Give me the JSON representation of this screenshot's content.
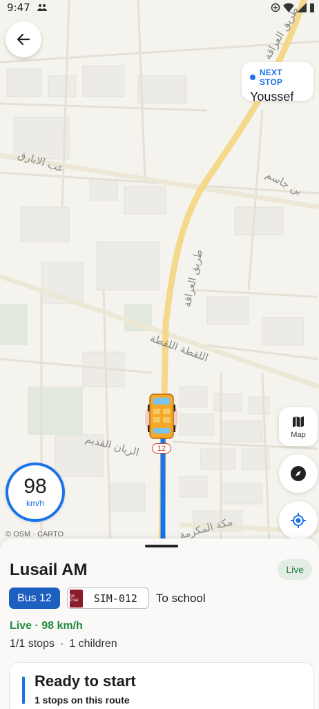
{
  "status_bar": {
    "time": "9:47"
  },
  "map": {
    "next_stop_label": "NEXT STOP",
    "next_stop_name": "Youssef",
    "map_button_label": "Map",
    "speed_value": "98",
    "speed_unit": "km/h",
    "attribution": "© OSM · CARTO",
    "route_number_badge": "12",
    "street_labels": [
      "طريق العراقة",
      "عب الابارق",
      "بن جاسم",
      "اللقطة اللقطة",
      "الريان القديم",
      "مكة المكرمة"
    ]
  },
  "sheet": {
    "route_name": "Lusail AM",
    "live_badge": "Live",
    "bus_label": "Bus 12",
    "plate_flag": "QA KTAR",
    "plate_number": "SIM-012",
    "direction": "To school",
    "live_speed": "Live · 98 km/h",
    "stops": "1/1 stops",
    "separator": "·",
    "children": "1 children",
    "card_title": "Ready to start",
    "card_subtitle": "1 stops on this route"
  },
  "colors": {
    "accent": "#1a73e8",
    "live_green": "#1e8a3e",
    "bus_chip": "#1c5fbf",
    "road_major": "#f4d98c"
  }
}
